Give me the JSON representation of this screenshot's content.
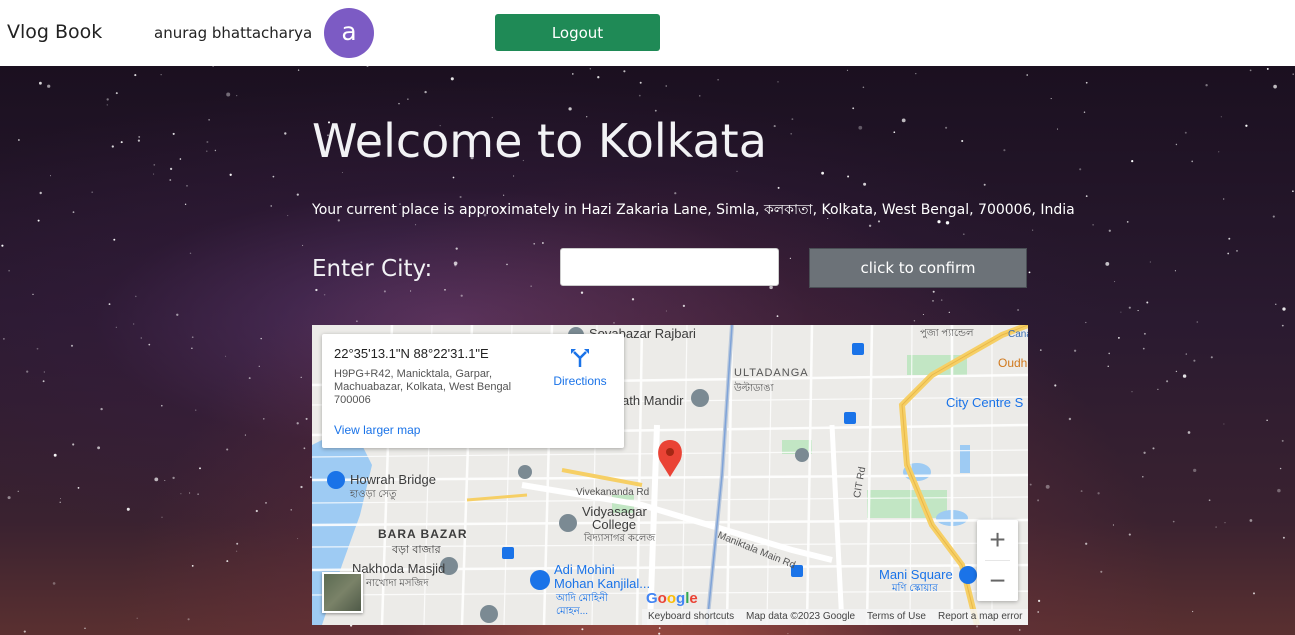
{
  "navbar": {
    "brand": "Vlog Book",
    "username": "anurag bhattacharya",
    "avatar_letter": "a",
    "logout_label": "Logout"
  },
  "hero": {
    "title": "Welcome to Kolkata",
    "location_text": "Your current place is approximately in Hazi Zakaria Lane, Simla, কলকাতা, Kolkata, West Bengal, 700006, India",
    "city_label": "Enter City:",
    "city_input_value": "",
    "confirm_label": "click to confirm"
  },
  "map": {
    "coords": "22°35'13.1\"N 88°22'31.1\"E",
    "address": "H9PG+R42, Manicktala, Garpar, Machuabazar, Kolkata, West Bengal 700006",
    "directions_label": "Directions",
    "larger_map_label": "View larger map",
    "labels": {
      "sovabazar": "Sovabazar Rajbari",
      "ultadanga": "ULTADANGA",
      "ultadanga_bn": "উল্টাডাঙা",
      "city_centre": "City Centre S",
      "oudh": "Oudh",
      "path_mandir": "ath Mandir",
      "howrah_bridge": "Howrah Bridge",
      "howrah_bridge_bn": "হাওড়া সেতু",
      "vivekananda": "Vivekananda Rd",
      "vidyasagar": "Vidyasagar",
      "college": "College",
      "college_bn": "বিদ্যাসাগর কলেজ",
      "maniktala_main": "Maniktala Main Rd",
      "cit_rd": "CIT Rd",
      "bara_bazar": "BARA BAZAR",
      "bara_bazar_bn": "বড়া বাজার",
      "nakhoda": "Nakhoda Masjid",
      "nakhoda_bn": "নাখোদা মসজিদ",
      "adi_mohini": "Adi Mohini",
      "mohan_kanjilal": "Mohan Kanjilal...",
      "adi_bn": "আদি মোহিনী",
      "adi_bn2": "মোহন...",
      "mani_square": "Mani Square",
      "mani_square_bn": "মণি স্কোয়ার",
      "puja": "পুজা প্যান্ডেল",
      "canal": "Cana"
    },
    "zoom_in": "+",
    "zoom_out": "−",
    "google": [
      "G",
      "o",
      "o",
      "g",
      "l",
      "e"
    ],
    "attribution": {
      "shortcuts": "Keyboard shortcuts",
      "map_data": "Map data ©2023 Google",
      "terms": "Terms of Use",
      "report": "Report a map error"
    }
  },
  "colors": {
    "logout_green": "#1f8a56",
    "avatar_purple": "#7c5bc4",
    "confirm_gray": "#6c7278",
    "link_blue": "#1a73e8",
    "marker_red": "#ea4335",
    "highway_yellow": "#f6cf65",
    "water_blue": "#9ecbf3",
    "park_green": "#c2e6c4"
  }
}
